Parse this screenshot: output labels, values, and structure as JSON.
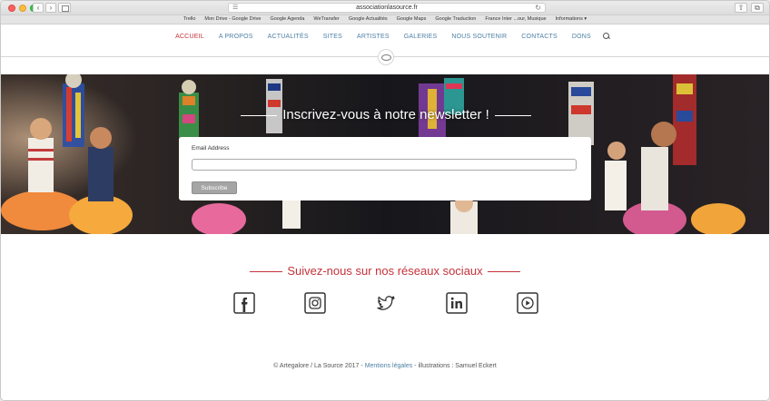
{
  "browser": {
    "url": "associationlasource.fr",
    "bookmarks": [
      "Trello",
      "Mon Drive - Google Drive",
      "Google Agenda",
      "WeTransfer",
      "Google Actualités",
      "Google Maps",
      "Google Traduction",
      "France Inter ...our, Musique",
      "Informations ▾"
    ]
  },
  "nav": {
    "items": [
      "ACCUEIL",
      "A PROPOS",
      "ACTUALITÉS",
      "SITES",
      "ARTISTES",
      "GALERIES",
      "NOUS SOUTENIR",
      "CONTACTS",
      "DONS"
    ],
    "active_index": 0
  },
  "hero": {
    "title": "Inscrivez-vous à notre newsletter !",
    "email_label": "Email Address",
    "email_value": "",
    "subscribe_label": "Subscribe"
  },
  "social": {
    "title": "Suivez-nous sur nos réseaux sociaux",
    "icons": [
      "facebook-icon",
      "instagram-icon",
      "twitter-icon",
      "linkedin-icon",
      "youtube-icon"
    ]
  },
  "footer": {
    "prefix": "© Artegalore / La Source 2017 -",
    "link": "Mentions légales",
    "suffix": "- illustrations : Samuel Eckert"
  },
  "colors": {
    "accent_red": "#c4323a",
    "nav_blue": "#4c7fa4"
  }
}
